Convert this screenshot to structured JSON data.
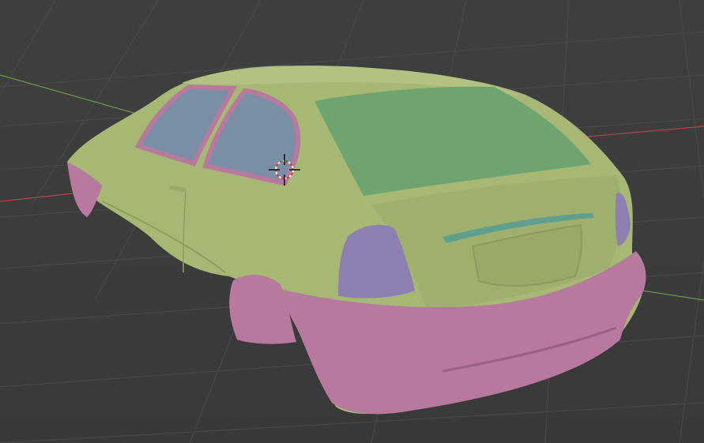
{
  "viewport": {
    "background_color": "#3d3d3d",
    "grid_color": "#4a4a4a",
    "x_axis_color": "#b24a4a",
    "y_axis_color": "#6a9a45"
  },
  "model": {
    "body_color": "#a6b874",
    "glass_color": "#7a8fa6",
    "rear_window_color": "#6fa36f",
    "bumper_color": "#b77a9e",
    "lamp_color": "#8d7fb0",
    "spoiler_color": "#5f9f8d"
  },
  "cursor": {
    "icon": "3d-cursor-icon",
    "ring_color": "#d63b3b"
  }
}
